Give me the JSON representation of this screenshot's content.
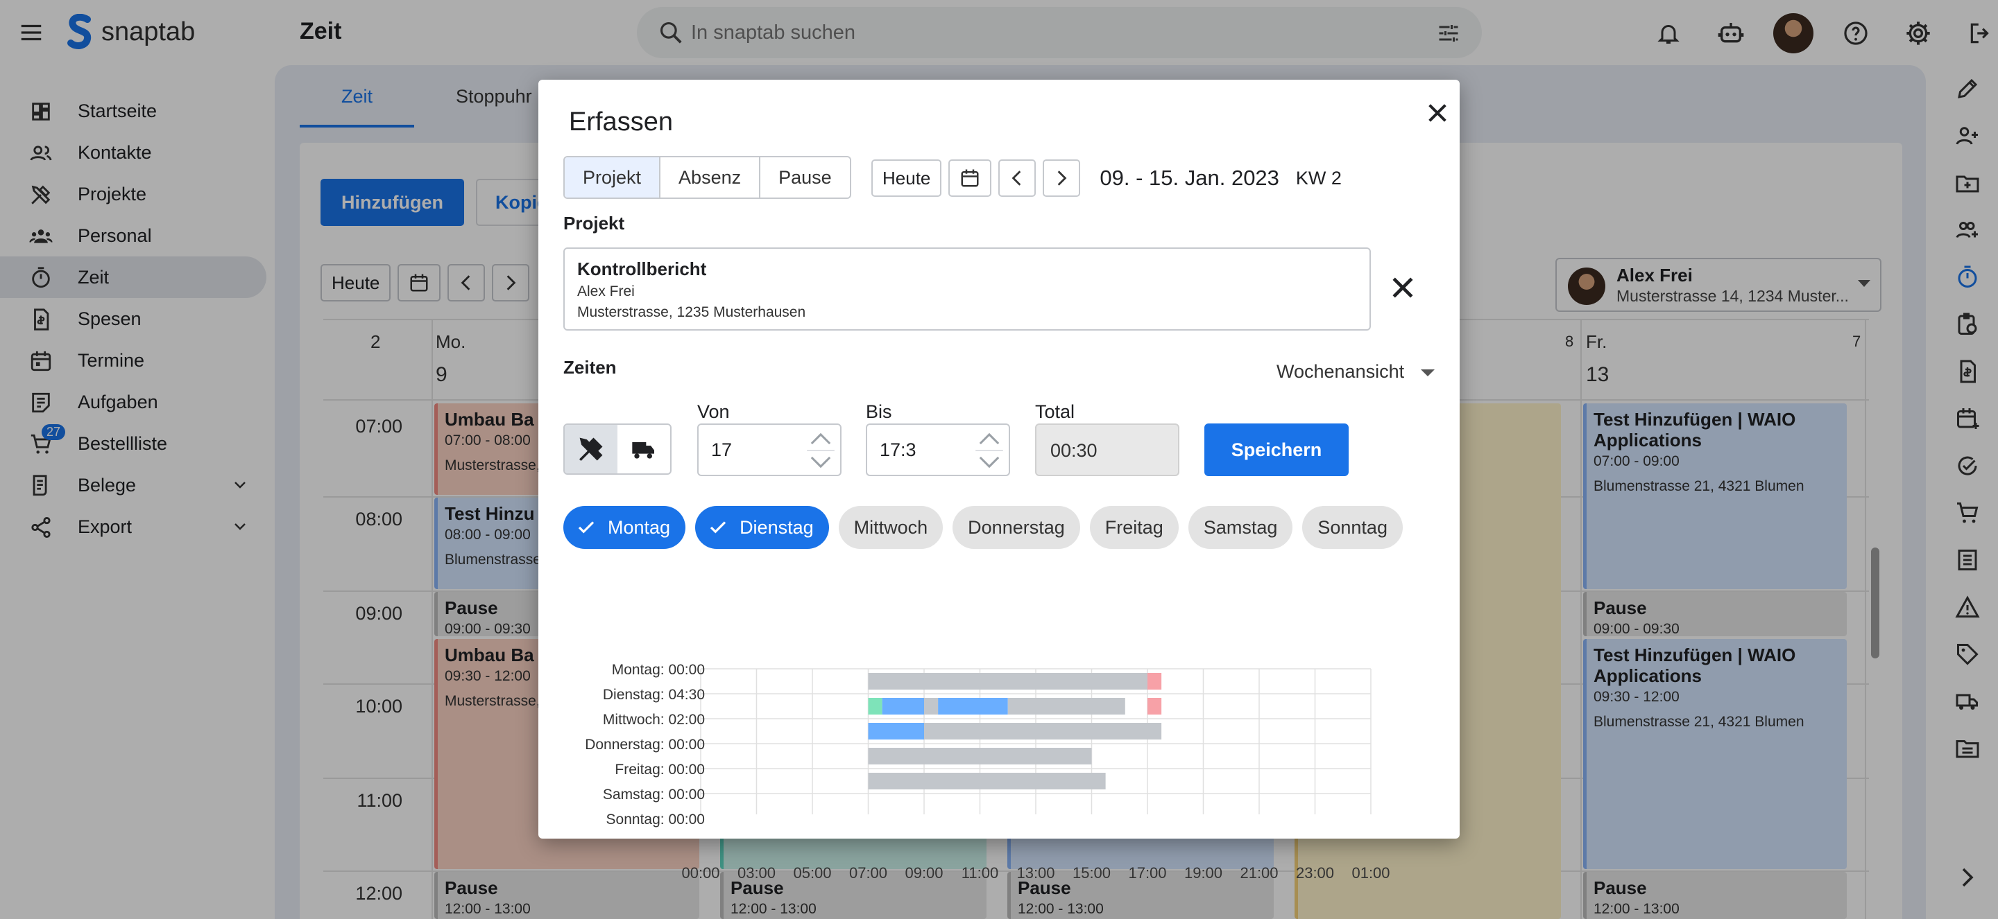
{
  "app": {
    "brand": "snaptab",
    "page_title": "Zeit",
    "search_placeholder": "In snaptab suchen",
    "accent_color": "#1a73e8"
  },
  "top_icons": [
    "bell-icon",
    "robot-icon",
    "avatar",
    "help-icon",
    "gear-icon",
    "logout-icon"
  ],
  "sidebar": {
    "items": [
      {
        "label": "Startseite",
        "icon": "dashboard-icon"
      },
      {
        "label": "Kontakte",
        "icon": "contacts-icon"
      },
      {
        "label": "Projekte",
        "icon": "tools-icon"
      },
      {
        "label": "Personal",
        "icon": "people-icon"
      },
      {
        "label": "Zeit",
        "icon": "timer-icon",
        "active": true
      },
      {
        "label": "Spesen",
        "icon": "receipt-icon"
      },
      {
        "label": "Termine",
        "icon": "calendar-icon"
      },
      {
        "label": "Aufgaben",
        "icon": "tasks-icon"
      },
      {
        "label": "Bestellliste",
        "icon": "cart-icon",
        "badge": "27"
      },
      {
        "label": "Belege",
        "icon": "receipt-long-icon",
        "expandable": true
      },
      {
        "label": "Export",
        "icon": "share-icon",
        "expandable": true
      }
    ]
  },
  "main": {
    "tabs": [
      "Zeit",
      "Stoppuhr"
    ],
    "add_button": "Hinzufügen",
    "copy_button": "Kopie",
    "today_button": "Heute",
    "person": {
      "name": "Alex Frei",
      "address": "Musterstrasse 14, 1234 Muster..."
    },
    "week_number_cells": [
      "2",
      "8",
      "7"
    ],
    "days": [
      {
        "name": "Mo.",
        "date": "9"
      },
      {
        "name": "Fr.",
        "date": "13"
      }
    ],
    "time_labels": [
      "07:00",
      "08:00",
      "09:00",
      "10:00",
      "11:00",
      "12:00"
    ],
    "events_monday": [
      {
        "title": "Umbau Ba",
        "time": "07:00 - 08:00",
        "addr": "Musterstrasse,"
      },
      {
        "title": "Test Hinzu",
        "time": "08:00 - 09:00",
        "addr": "Blumenstrasse"
      },
      {
        "title": "Pause",
        "time": "09:00 - 09:30"
      },
      {
        "title": "Umbau Ba",
        "time": "09:30 - 12:00",
        "addr": "Musterstrasse,"
      },
      {
        "title": "Pause",
        "time": "12:00 - 13:00"
      }
    ],
    "events_friday": [
      {
        "title": "Test Hinzufügen | WAIO Applications",
        "time": "07:00 - 09:00",
        "addr": "Blumenstrasse 21, 4321 Blumen"
      },
      {
        "title": "Pause",
        "time": "09:00 - 09:30"
      },
      {
        "title": "Test Hinzufügen | WAIO Applications",
        "time": "09:30 - 12:00",
        "addr": "Blumenstrasse 21, 4321 Blumen"
      },
      {
        "title": "Pause",
        "time": "12:00 - 13:00"
      }
    ],
    "other_pause": [
      "Pause",
      "Pause"
    ],
    "other_pause_time": [
      "12:00 - 13:00",
      "12:00 - 13:00"
    ]
  },
  "dialog": {
    "title": "Erfassen",
    "segments": [
      "Projekt",
      "Absenz",
      "Pause"
    ],
    "active_segment": "Projekt",
    "today": "Heute",
    "date_range": "09. - 15. Jan. 2023",
    "week": "KW 2",
    "project_label": "Projekt",
    "project": {
      "title": "Kontrollbericht",
      "person": "Alex Frei",
      "address": "Musterstrasse, 1235 Musterhausen"
    },
    "times_label": "Zeiten",
    "view_select": "Wochenansicht",
    "von_label": "Von",
    "von_value": "17",
    "bis_label": "Bis",
    "bis_value": "17:3",
    "total_label": "Total",
    "total_value": "00:30",
    "save": "Speichern",
    "days": [
      {
        "label": "Montag",
        "on": true
      },
      {
        "label": "Dienstag",
        "on": true
      },
      {
        "label": "Mittwoch",
        "on": false
      },
      {
        "label": "Donnerstag",
        "on": false
      },
      {
        "label": "Freitag",
        "on": false
      },
      {
        "label": "Samstag",
        "on": false
      },
      {
        "label": "Sonntag",
        "on": false
      }
    ]
  },
  "chart_data": {
    "type": "bar",
    "orientation": "horizontal",
    "categories": [
      "Montag: 00:00",
      "Dienstag: 04:30",
      "Mittwoch: 02:00",
      "Donnerstag: 00:00",
      "Freitag: 00:00",
      "Samstag: 00:00",
      "Sonntag: 00:00"
    ],
    "x_ticks": [
      "00:00",
      "03:00",
      "05:00",
      "07:00",
      "09:00",
      "11:00",
      "13:00",
      "15:00",
      "17:00",
      "19:00",
      "21:00",
      "23:00",
      "01:00"
    ],
    "xlim": [
      0,
      24
    ],
    "colors": {
      "existing": "#c2c6cb",
      "project": "#6aaeff",
      "pause": "#c2c6cb",
      "new_entry": "#f7a1a7",
      "absence": "#7ee3b9"
    },
    "rows": [
      {
        "segments": [
          {
            "start": 7.0,
            "end": 17.0,
            "kind": "existing"
          },
          {
            "start": 17.0,
            "end": 17.5,
            "kind": "new_entry"
          }
        ]
      },
      {
        "segments": [
          {
            "start": 7.0,
            "end": 7.5,
            "kind": "absence"
          },
          {
            "start": 7.5,
            "end": 9.0,
            "kind": "project"
          },
          {
            "start": 9.0,
            "end": 9.5,
            "kind": "pause"
          },
          {
            "start": 9.5,
            "end": 12.0,
            "kind": "project"
          },
          {
            "start": 12.0,
            "end": 16.2,
            "kind": "existing"
          },
          {
            "start": 17.0,
            "end": 17.5,
            "kind": "new_entry"
          }
        ]
      },
      {
        "segments": [
          {
            "start": 7.0,
            "end": 9.0,
            "kind": "project"
          },
          {
            "start": 9.0,
            "end": 17.5,
            "kind": "existing"
          }
        ]
      },
      {
        "segments": [
          {
            "start": 7.0,
            "end": 15.0,
            "kind": "existing"
          }
        ]
      },
      {
        "segments": [
          {
            "start": 7.0,
            "end": 15.5,
            "kind": "existing"
          }
        ]
      },
      {
        "segments": []
      },
      {
        "segments": []
      }
    ]
  }
}
